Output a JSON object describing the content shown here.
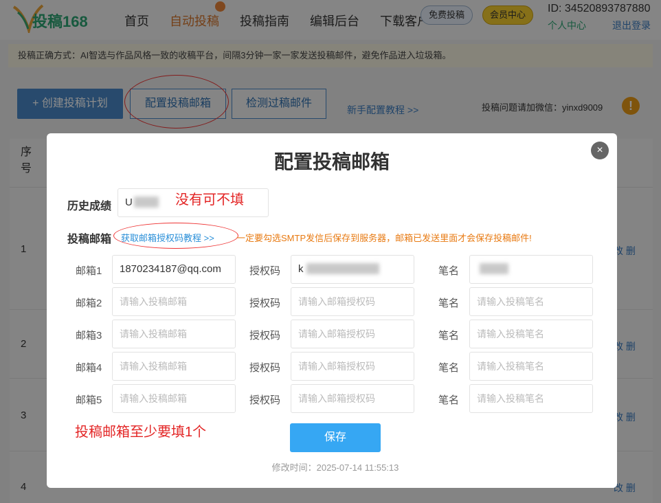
{
  "header": {
    "logo_text": "投稿168",
    "nav": [
      "首页",
      "自动投稿",
      "投稿指南",
      "编辑后台",
      "下载客户"
    ],
    "free_button": "免费投稿",
    "vip_button": "会员中心",
    "user_id": "ID: 34520893787880",
    "personal_center": "个人中心",
    "logout": "退出登录",
    "accent_color": "#d4742a"
  },
  "notice": "投稿正确方式：AI智选与作品风格一致的收稿平台，间隔3分钟一家一家发送投稿邮件，避免作品进入垃圾箱。",
  "toolbar": {
    "create_plan": "+ 创建投稿计划",
    "config_mailbox": "配置投稿邮箱",
    "check_mail": "检测过稿邮件",
    "tutorial_link": "新手配置教程 >>",
    "wechat": "投稿问题请加微信：yinxd9009",
    "info_icon": "!"
  },
  "table": {
    "seq_header": "序号",
    "rows": [
      {
        "num": "1",
        "actions": "改 删"
      },
      {
        "num": "2",
        "actions": "改 删"
      },
      {
        "num": "3",
        "actions": "改 删"
      },
      {
        "num": "4",
        "actions": "改 删"
      }
    ]
  },
  "modal": {
    "title": "配置投稿邮箱",
    "close": "×",
    "history_label": "历史成绩",
    "history_value": "U",
    "history_note": "没有可不填",
    "mailbox_label": "投稿邮箱",
    "auth_tutorial": "获取邮箱授权码教程 >>",
    "smtp_tip": "一定要勾选SMTP发信后保存到服务器，邮箱已发送里面才会保存投稿邮件!",
    "min_note": "投稿邮箱至少要填1个",
    "rows": [
      {
        "mail_label": "邮箱1",
        "mail_value": "1870234187@qq.com",
        "auth_label": "授权码",
        "auth_value": "k",
        "pen_label": "笔名",
        "pen_value": ""
      },
      {
        "mail_label": "邮箱2",
        "mail_value": "请输入投稿邮箱",
        "auth_label": "授权码",
        "auth_value": "请输入邮箱授权码",
        "pen_label": "笔名",
        "pen_value": "请输入投稿笔名"
      },
      {
        "mail_label": "邮箱3",
        "mail_value": "请输入投稿邮箱",
        "auth_label": "授权码",
        "auth_value": "请输入邮箱授权码",
        "pen_label": "笔名",
        "pen_value": "请输入投稿笔名"
      },
      {
        "mail_label": "邮箱4",
        "mail_value": "请输入投稿邮箱",
        "auth_label": "授权码",
        "auth_value": "请输入邮箱授权码",
        "pen_label": "笔名",
        "pen_value": "请输入投稿笔名"
      },
      {
        "mail_label": "邮箱5",
        "mail_value": "请输入投稿邮箱",
        "auth_label": "授权码",
        "auth_value": "请输入邮箱授权码",
        "pen_label": "笔名",
        "pen_value": "请输入投稿笔名"
      }
    ],
    "save_button": "保存",
    "modified_time": "修改时间：2025-07-14 11:55:13",
    "save_color": "#36a7f3",
    "annotation_color": "#e32525"
  }
}
